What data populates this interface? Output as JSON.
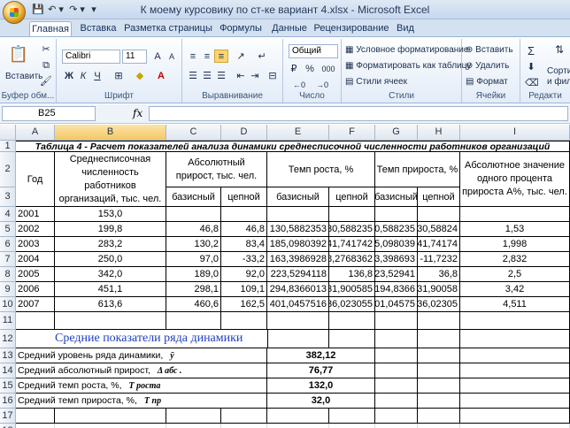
{
  "window": {
    "title": "К моему курсовику по ст-ке вариант 4.xlsx - Microsoft Excel",
    "quick_access": [
      "💾",
      "↶ ▾",
      "↷ ▾",
      "▾"
    ]
  },
  "tabs": [
    "Главная",
    "Вставка",
    "Разметка страницы",
    "Формулы",
    "Данные",
    "Рецензирование",
    "Вид"
  ],
  "ribbon": {
    "clipboard": {
      "paste": "Вставить",
      "label": "Буфер обм..."
    },
    "font": {
      "name": "Calibri",
      "size": "11",
      "bold": "Ж",
      "italic": "К",
      "underline": "Ч",
      "label": "Шрифт"
    },
    "alignment": {
      "label": "Выравнивание"
    },
    "number": {
      "format": "Общий",
      "percent": "%",
      "thousands": "000",
      "label": "Число"
    },
    "styles": {
      "conditional": "Условное форматирование",
      "table": "Форматировать как таблицу",
      "cell_styles": "Стили ячеек",
      "label": "Стили"
    },
    "cells": {
      "insert": "Вставить",
      "delete": "Удалить",
      "format": "Формат",
      "label": "Ячейки"
    },
    "editing": {
      "sigma": "Σ",
      "sort": "Сортир",
      "filter": "и фил",
      "label": "Редакти"
    }
  },
  "formula_bar": {
    "name_box": "B25",
    "fx": "fx",
    "value": ""
  },
  "columns": [
    "A",
    "B",
    "C",
    "D",
    "E",
    "F",
    "G",
    "H",
    "I"
  ],
  "rows": [
    "1",
    "2",
    "3",
    "4",
    "5",
    "6",
    "7",
    "8",
    "9",
    "10",
    "11",
    "12",
    "13",
    "14",
    "15",
    "16",
    "17",
    "18"
  ],
  "sheet": {
    "title": "Таблица 4 - Расчет показателей анализа динамики среднесписочной численности работников организаций",
    "headers": {
      "year": "Год",
      "avg_count": "Среднесписочная численность работников организаций, тыс. чел.",
      "abs_growth": "Абсолютный прирост, тыс. чел.",
      "growth_rate": "Темп роста, %",
      "increase_rate": "Темп прироста, %",
      "abs_value": "Абсолютное значение одного процента прироста А%, тыс. чел.",
      "basic": "базисный",
      "chain": "цепной"
    },
    "data": [
      [
        "2001",
        "153,0",
        "",
        "",
        "",
        "",
        "",
        "",
        ""
      ],
      [
        "2002",
        "199,8",
        "46,8",
        "46,8",
        "130,5882353",
        "130,588235",
        "30,588235",
        "30,58824",
        "1,53"
      ],
      [
        "2003",
        "283,2",
        "130,2",
        "83,4",
        "185,0980392",
        "141,741742",
        "85,098039",
        "41,74174",
        "1,998"
      ],
      [
        "2004",
        "250,0",
        "97,0",
        "-33,2",
        "163,3986928",
        "88,2768362",
        "63,398693",
        "-11,7232",
        "2,832"
      ],
      [
        "2005",
        "342,0",
        "189,0",
        "92,0",
        "223,5294118",
        "136,8",
        "123,52941",
        "36,8",
        "2,5"
      ],
      [
        "2006",
        "451,1",
        "298,1",
        "109,1",
        "294,8366013",
        "131,900585",
        "194,8366",
        "31,90058",
        "3,42"
      ],
      [
        "2007",
        "613,6",
        "460,6",
        "162,5",
        "401,0457516",
        "136,023055",
        "301,04575",
        "36,02305",
        "4,511"
      ]
    ],
    "averages_title": "Средние показатели ряда динамики",
    "averages": [
      {
        "label": "Средний уровень ряда динамики,",
        "symbol": "ȳ",
        "value": "382,12"
      },
      {
        "label": "Средний абсолютный прирост,",
        "symbol": "Δ абс .",
        "value": "76,77"
      },
      {
        "label": "Средний темп роста, %,",
        "symbol": "T роста",
        "value": "132,0"
      },
      {
        "label": "Средний темп прироста, %,",
        "symbol": "T пр",
        "value": "32,0"
      }
    ]
  }
}
